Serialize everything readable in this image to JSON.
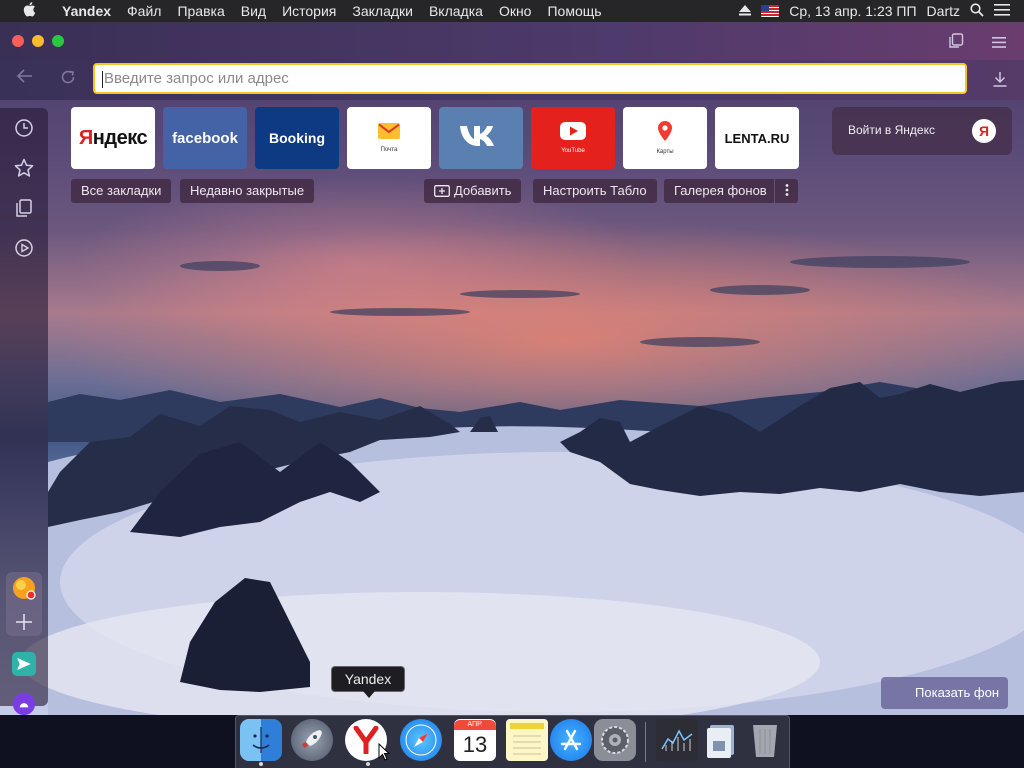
{
  "menubar": {
    "app_name": "Yandex",
    "items": [
      "Файл",
      "Правка",
      "Вид",
      "История",
      "Закладки",
      "Вкладка",
      "Окно",
      "Помощь"
    ],
    "clock": "Ср, 13 апр.  1:23 ПП",
    "user": "Dartz"
  },
  "browser": {
    "address_placeholder": "Введите запрос или адрес"
  },
  "tiles": [
    {
      "label": "Яндекс",
      "bg": "#ffffff",
      "color": "#111111"
    },
    {
      "label": "facebook",
      "bg": "#4463a7",
      "color": "#ffffff"
    },
    {
      "label": "Booking",
      "bg": "#0d3a82",
      "color": "#ffffff"
    },
    {
      "label": "Почта",
      "bg": "#ffffff",
      "color": "#333333"
    },
    {
      "label": "VK",
      "bg": "#5a80b1",
      "color": "#ffffff"
    },
    {
      "label": "YouTube",
      "bg": "#e5211d",
      "color": "#ffffff"
    },
    {
      "label": "Карты",
      "bg": "#ffffff",
      "color": "#333333"
    },
    {
      "label": "LENTA.RU",
      "bg": "#ffffff",
      "color": "#111111"
    }
  ],
  "actions": {
    "all_bookmarks": "Все закладки",
    "recently_closed": "Недавно закрытые",
    "add": "Добавить",
    "customize": "Настроить Табло",
    "gallery": "Галерея фонов"
  },
  "login": {
    "label": "Войти в Яндекс",
    "logo": "Я"
  },
  "show_background": "Показать фон",
  "dock": {
    "tooltip": "Yandex",
    "calendar_month": "АПР.",
    "calendar_day": "13"
  },
  "colors": {
    "accent_yellow": "#f5c623",
    "yandex_red": "#e02020"
  }
}
